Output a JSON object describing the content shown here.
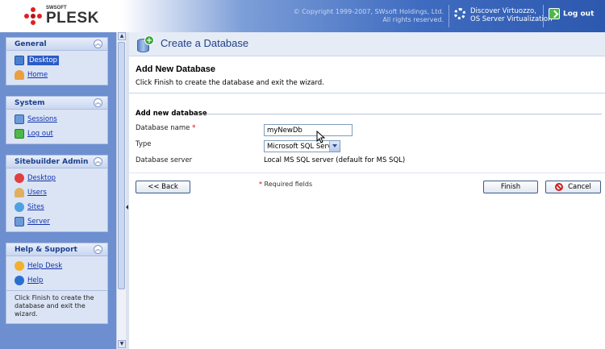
{
  "header": {
    "logo": {
      "vendor": "SWSOFT",
      "product": "PLESK"
    },
    "copyright_line1": "© Copyright 1999-2007, SWsoft Holdings, Ltd.",
    "copyright_line2": "All rights reserved.",
    "discover_line1": "Discover Virtuozzo,",
    "discover_line2": "OS Server Virtualization",
    "logout_label": "Log out"
  },
  "sidebar": {
    "panels": [
      {
        "title": "General",
        "items": [
          {
            "label": "Desktop",
            "icon": "desktop-icon",
            "active": true
          },
          {
            "label": "Home",
            "icon": "home-icon"
          }
        ]
      },
      {
        "title": "System",
        "items": [
          {
            "label": "Sessions",
            "icon": "sessions-icon"
          },
          {
            "label": "Log out",
            "icon": "logout-icon"
          }
        ]
      },
      {
        "title": "Sitebuilder Admin",
        "items": [
          {
            "label": "Desktop",
            "icon": "sitebuilder-desktop-icon"
          },
          {
            "label": "Users",
            "icon": "users-icon"
          },
          {
            "label": "Sites",
            "icon": "sites-icon"
          },
          {
            "label": "Server",
            "icon": "server-icon"
          }
        ]
      },
      {
        "title": "Help & Support",
        "items": [
          {
            "label": "Help Desk",
            "icon": "help-desk-icon"
          },
          {
            "label": "Help",
            "icon": "help-icon"
          }
        ],
        "help_text": "Click Finish to create the database and exit the wizard."
      }
    ]
  },
  "main": {
    "page_title": "Create a Database",
    "section_title": "Add New Database",
    "section_desc": "Click Finish to create the database and exit the wizard.",
    "group_title": "Add new database",
    "fields": {
      "db_name_label": "Database name",
      "db_name_value": "myNewDb",
      "type_label": "Type",
      "type_value": "Microsoft SQL Server",
      "server_label": "Database server",
      "server_value": "Local MS SQL server (default for MS SQL)"
    },
    "required_note": "Required fields",
    "buttons": {
      "back": "<< Back",
      "finish": "Finish",
      "cancel": "Cancel"
    }
  },
  "colors": {
    "accent": "#2c58ae",
    "sidebar_bg": "#6d8fcf",
    "title_text": "#1f3f87",
    "required": "#dd0000"
  }
}
